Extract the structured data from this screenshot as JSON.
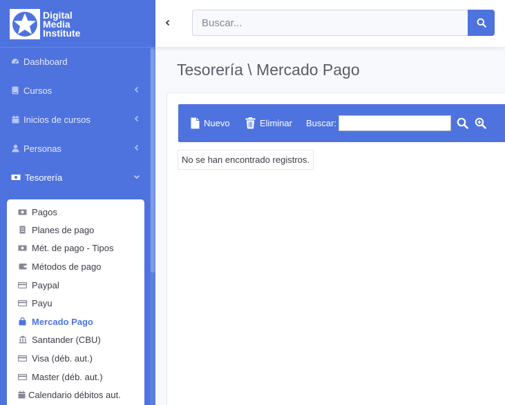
{
  "brand": {
    "lines": [
      "Digital",
      "Media",
      "Institute"
    ],
    "logo_icon": "star-logo"
  },
  "sidebar": {
    "items": [
      {
        "label": "Dashboard",
        "icon": "tachometer-icon",
        "chevron": "none"
      },
      {
        "label": "Cursos",
        "icon": "book-icon",
        "chevron": "left"
      },
      {
        "label": "Inicios de cursos",
        "icon": "calendar-icon",
        "chevron": "left"
      },
      {
        "label": "Personas",
        "icon": "user-icon",
        "chevron": "left"
      },
      {
        "label": "Tesorería",
        "icon": "money-bill-icon",
        "chevron": "down"
      }
    ],
    "submenu": [
      {
        "label": "Pagos",
        "icon": "money-bill-icon",
        "active": false
      },
      {
        "label": "Planes de pago",
        "icon": "list-icon",
        "active": false
      },
      {
        "label": "Mét. de pago - Tipos",
        "icon": "money-bill-icon",
        "active": false
      },
      {
        "label": "Métodos de pago",
        "icon": "wallet-icon",
        "active": false
      },
      {
        "label": "Paypal",
        "icon": "credit-card-icon",
        "active": false
      },
      {
        "label": "Payu",
        "icon": "credit-card-icon",
        "active": false
      },
      {
        "label": "Mercado Pago",
        "icon": "shopping-bag-icon",
        "active": true
      },
      {
        "label": "Santander (CBU)",
        "icon": "bank-icon",
        "active": false
      },
      {
        "label": "Visa (déb. aut.)",
        "icon": "credit-card-icon",
        "active": false
      },
      {
        "label": "Master (déb. aut.)",
        "icon": "credit-card-icon",
        "active": false
      },
      {
        "label": "Calendario débitos aut.",
        "icon": "calendar-icon",
        "active": false
      }
    ]
  },
  "topbar": {
    "search_placeholder": "Buscar...",
    "search_value": ""
  },
  "page": {
    "title": "Tesorería \\ Mercado Pago",
    "toolbar": {
      "new_label": "Nuevo",
      "delete_label": "Eliminar",
      "search_label": "Buscar:",
      "search_value": ""
    },
    "empty_message": "No se han encontrado registros."
  },
  "colors": {
    "primary": "#4e73df",
    "text": "#5a5c69",
    "active_submenu": "#4e73df"
  }
}
